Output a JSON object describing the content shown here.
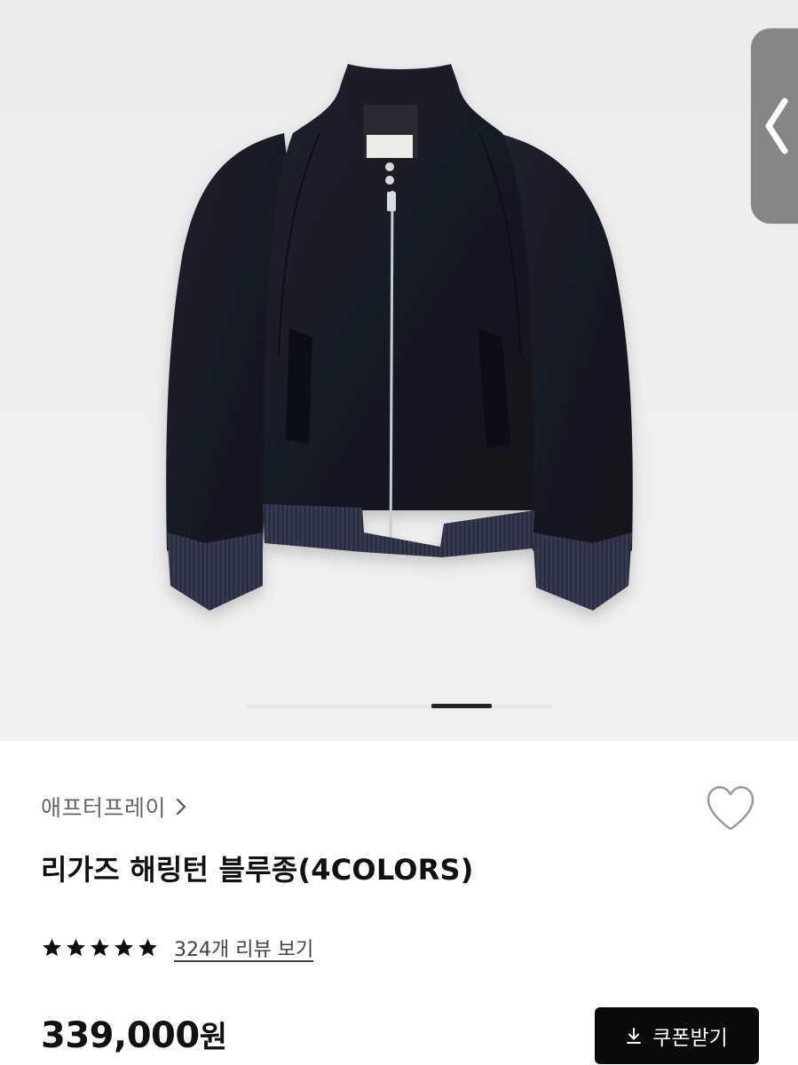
{
  "gallery": {
    "image_alt": "jacket-photo",
    "current_slide": 3,
    "handle_icon": "chevron-left-icon"
  },
  "product": {
    "brand": "애프터프레이",
    "name": "리가즈 해링턴 블루종(4COLORS)",
    "rating": 5,
    "review_link": "324개 리뷰 보기",
    "price": "339,000",
    "price_unit": "원"
  },
  "actions": {
    "coupon_label": "쿠폰받기",
    "coupon_icon": "download-icon",
    "wishlist_icon": "heart-icon"
  },
  "colors": {
    "hero_bg": "#ececee",
    "button_bg": "#0a0a0a",
    "handle_bg": "#868686"
  }
}
